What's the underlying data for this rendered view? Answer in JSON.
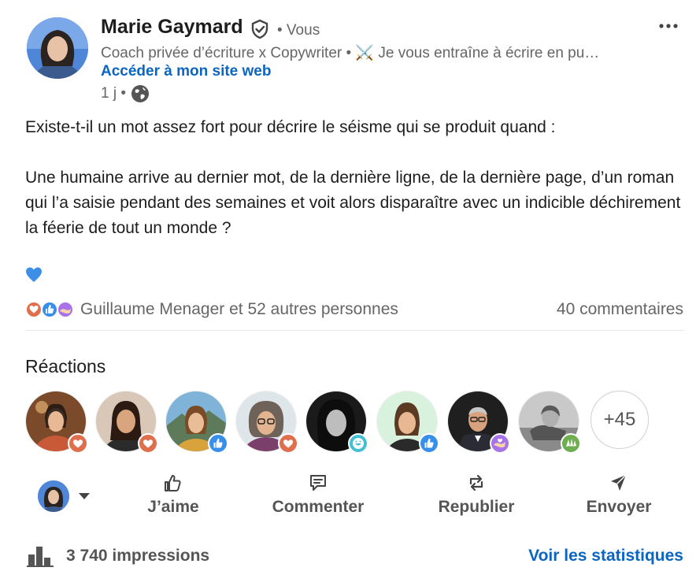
{
  "author": {
    "name": "Marie Gaymard",
    "you_label": "• Vous",
    "headline": "Coach privée d’écriture x Copywriter • ⚔️ Je vous entraîne à écrire en pu…",
    "website_label": "Accéder à mon site web",
    "time": "1 j •",
    "avatar_icon": "profile-photo",
    "verified_icon": "verified-shield-icon",
    "visibility_icon": "globe-icon"
  },
  "menu_icon": "more-horizontal-icon",
  "post": {
    "paragraphs": [
      "Existe-t-il un mot assez fort pour décrire le séisme qui se produit quand :",
      "Une humaine arrive au dernier mot, de la dernière ligne, de la dernière page, d’un roman qui l’a saisie pendant des semaines et voit alors disparaître avec un indicible déchirement la féerie de tout un monde ?"
    ],
    "emoji": "blue-heart"
  },
  "social": {
    "reactors_text": "Guillaume Menager et 52 autres personnes",
    "comments_text": "40 commentaires",
    "reaction_types": [
      "love",
      "like",
      "support"
    ]
  },
  "reactions": {
    "title": "Réactions",
    "people": [
      {
        "badge": "love"
      },
      {
        "badge": "love"
      },
      {
        "badge": "like"
      },
      {
        "badge": "love"
      },
      {
        "badge": "funny"
      },
      {
        "badge": "like"
      },
      {
        "badge": "support"
      },
      {
        "badge": "celebrate"
      }
    ],
    "more_label": "+45"
  },
  "actions": {
    "like": "J’aime",
    "comment": "Commenter",
    "repost": "Republier",
    "send": "Envoyer"
  },
  "footer": {
    "impressions": "3 740 impressions",
    "stats_link": "Voir les statistiques"
  },
  "colors": {
    "link_blue": "#0a66c2",
    "love": "#df704d",
    "like": "#378fe9",
    "support": "#a872e8",
    "celebrate": "#6dae4f",
    "funny": "#44bfd3"
  }
}
